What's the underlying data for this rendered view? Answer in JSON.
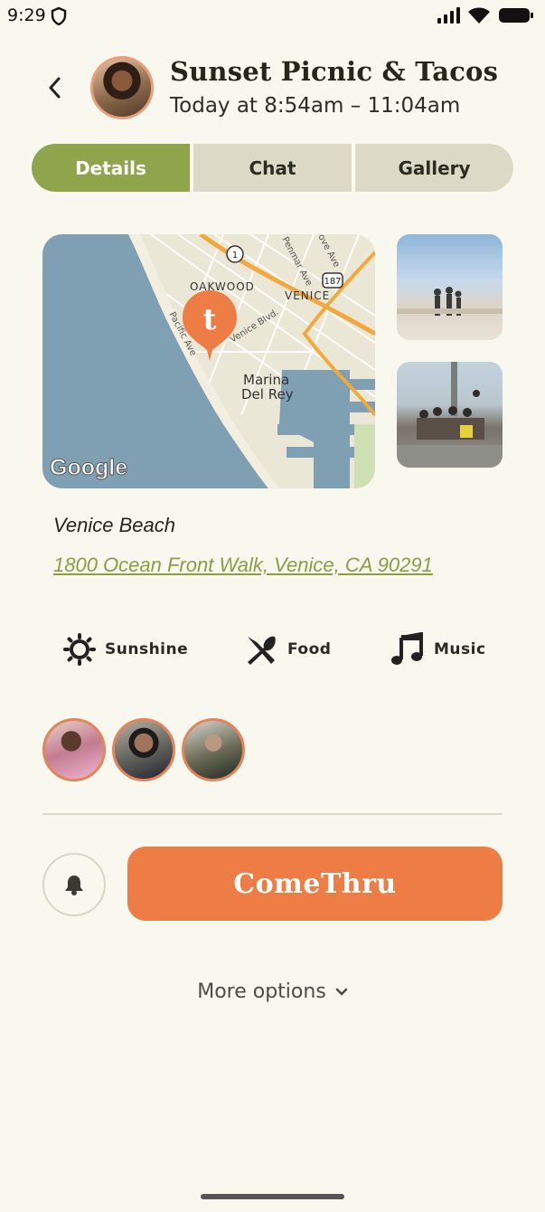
{
  "status_bar": {
    "time": "9:29"
  },
  "header": {
    "title": "Sunset Picnic & Tacos",
    "subtitle": "Today at 8:54am – 11:04am"
  },
  "tabs": [
    {
      "label": "Details",
      "active": true
    },
    {
      "label": "Chat",
      "active": false
    },
    {
      "label": "Gallery",
      "active": false
    }
  ],
  "map": {
    "labels": {
      "oakwood": "OAKWOOD",
      "venice": "VENICE",
      "marina": "Marina",
      "del_rey": "Del Rey",
      "venice_blvd": "Venice Blvd.",
      "pacific_ave": "Pacific Ave",
      "penmar": "Penmar Ave",
      "grove": "ove Ave",
      "route1": "1",
      "route187": "187",
      "google": "Google"
    },
    "colors": {
      "water": "#7ea0b2",
      "land": "#ebe7d6",
      "road": "#f2a93b",
      "pin": "#ee7d45"
    }
  },
  "location": {
    "name": "Venice Beach",
    "address": "1800 Ocean Front Walk, Venice, CA 90291"
  },
  "tags": [
    {
      "icon": "sun-icon",
      "label": "Sunshine"
    },
    {
      "icon": "utensils-icon",
      "label": "Food"
    },
    {
      "icon": "music-note-icon",
      "label": "Music"
    }
  ],
  "actions": {
    "cta_label": "ComeThru",
    "more_options": "More options"
  },
  "colors": {
    "background": "#f9f8ef",
    "accent_green": "#8fa44b",
    "accent_orange": "#ee7d45",
    "tab_inactive": "#dcdac6"
  }
}
